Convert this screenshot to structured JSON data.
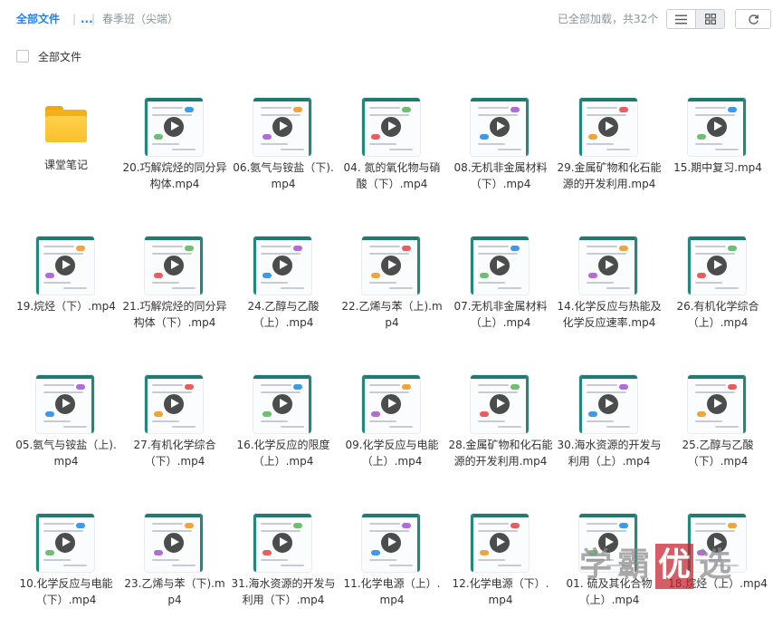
{
  "breadcrumb": {
    "root": "全部文件",
    "ellipsis": "...",
    "separator": "|",
    "current": "春季班（尖端）"
  },
  "load_status": "已全部加载，共32个",
  "toolbar": {
    "list_view_icon": "list-icon",
    "grid_view_icon": "grid-icon",
    "refresh_icon": "refresh-icon",
    "active_view": "grid"
  },
  "select_all_label": "全部文件",
  "files": [
    {
      "name": "课堂笔记",
      "type": "folder"
    },
    {
      "name": "20.巧解烷烃的同分异构体.mp4",
      "type": "video"
    },
    {
      "name": "06.氨气与铵盐（下).mp4",
      "type": "video"
    },
    {
      "name": "04. 氮的氧化物与硝酸（下）.mp4",
      "type": "video"
    },
    {
      "name": "08.无机非金属材料（下）.mp4",
      "type": "video"
    },
    {
      "name": "29.金属矿物和化石能源的开发利用.mp4",
      "type": "video"
    },
    {
      "name": "15.期中复习.mp4",
      "type": "video"
    },
    {
      "name": "19.烷烃（下）.mp4",
      "type": "video"
    },
    {
      "name": "21.巧解烷烃的同分异构体（下）.mp4",
      "type": "video"
    },
    {
      "name": "24.乙醇与乙酸（上）.mp4",
      "type": "video"
    },
    {
      "name": "22.乙烯与苯（上).mp4",
      "type": "video"
    },
    {
      "name": "07.无机非金属材料（上）.mp4",
      "type": "video"
    },
    {
      "name": "14.化学反应与热能及化学反应速率.mp4",
      "type": "video"
    },
    {
      "name": "26.有机化学综合（上）.mp4",
      "type": "video"
    },
    {
      "name": "05.氨气与铵盐（上).mp4",
      "type": "video"
    },
    {
      "name": "27.有机化学综合（下）.mp4",
      "type": "video"
    },
    {
      "name": "16.化学反应的限度（上）.mp4",
      "type": "video"
    },
    {
      "name": "09.化学反应与电能（上）.mp4",
      "type": "video"
    },
    {
      "name": "28.金属矿物和化石能源的开发利用.mp4",
      "type": "video"
    },
    {
      "name": "30.海水资源的开发与利用（上）.mp4",
      "type": "video"
    },
    {
      "name": "25.乙醇与乙酸（下）.mp4",
      "type": "video"
    },
    {
      "name": "10.化学反应与电能（下）.mp4",
      "type": "video"
    },
    {
      "name": "23.乙烯与苯（下).mp4",
      "type": "video"
    },
    {
      "name": "31.海水资源的开发与利用（下）.mp4",
      "type": "video"
    },
    {
      "name": "11.化学电源（上）.mp4",
      "type": "video"
    },
    {
      "name": "12.化学电源（下）.mp4",
      "type": "video"
    },
    {
      "name": "01. 硫及其化合物（上）.mp4",
      "type": "video"
    },
    {
      "name": "18.烷烃（上）.mp4",
      "type": "video"
    }
  ],
  "watermark": {
    "chars": [
      "学",
      "霸",
      "优",
      "选"
    ],
    "highlight_index": 2
  },
  "colors": {
    "accent": "#1e82ff",
    "muted_text": "#8d939c",
    "folder": "#fbc12d",
    "thumb_band": "#1f7a70",
    "watermark_red": "#c4202c"
  }
}
